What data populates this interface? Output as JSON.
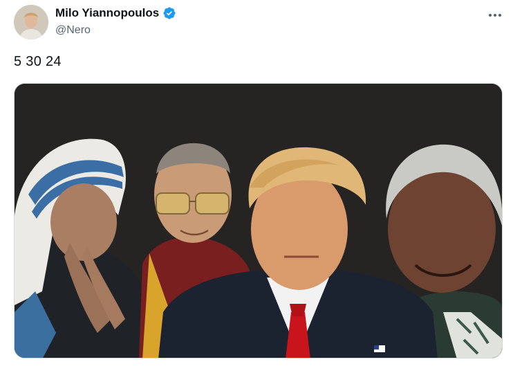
{
  "tweet": {
    "author_name": "Milo Yiannopoulos",
    "author_handle": "@Nero",
    "text": "5 30 24",
    "more_icon": "more-horizontal-icon",
    "verified_icon": "verified-badge-icon",
    "media": {
      "figures": [
        "nun-in-white-blue-headscarf-praying",
        "monk-in-maroon-robes-with-glasses",
        "man-in-dark-suit-red-tie",
        "smiling-man-with-white-hair-patterned-shirt"
      ]
    }
  },
  "colors": {
    "name": "#0f1419",
    "handle": "#536471",
    "verified": "#1d9bf0",
    "media_background": "#262323"
  }
}
